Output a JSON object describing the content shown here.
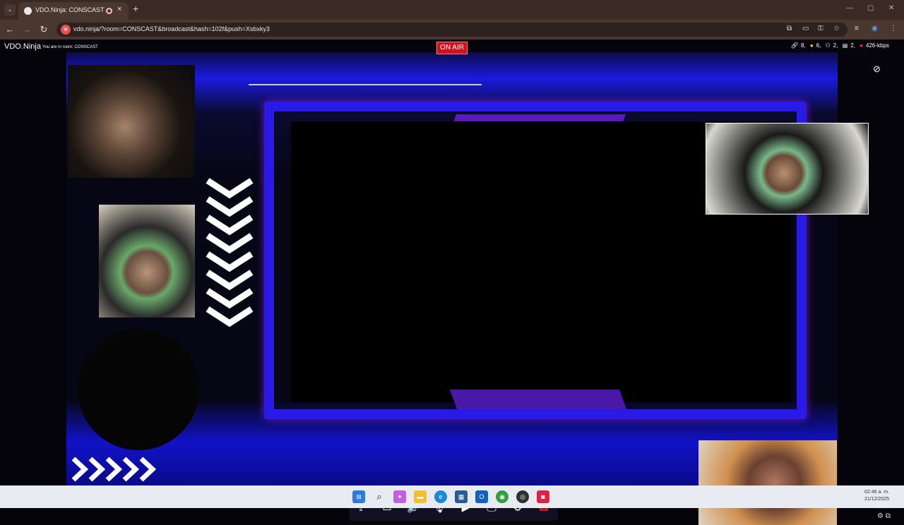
{
  "browser": {
    "tab_title": "VDO.Ninja: CONSCAST",
    "url": "vdo.ninja/?room=CONSCAST&broadcast&hash=102f&push=Xsbxky3",
    "nav": {
      "back": "←",
      "forward": "→",
      "reload": "↻"
    },
    "new_tab": "+",
    "tab_close": "×",
    "window_controls": [
      "—",
      "▢",
      "✕"
    ]
  },
  "app": {
    "brand": "VDO.Ninja",
    "room_label": "You are in room: CONSCAST",
    "on_air": "ON AIR",
    "stats": {
      "links": "8,",
      "bulbs": "6,",
      "viewers": "2,",
      "tabs": "2,",
      "bitrate": "426-kbps"
    }
  },
  "controls": {
    "items": [
      {
        "name": "file-share-icon",
        "glyph": "⇪"
      },
      {
        "name": "chat-icon",
        "glyph": "▭"
      },
      {
        "name": "speaker-icon",
        "glyph": "🔊"
      },
      {
        "name": "microphone-icon",
        "glyph": "🎙"
      },
      {
        "name": "camera-icon",
        "glyph": "▶"
      },
      {
        "name": "screenshare-icon",
        "glyph": "🖵"
      },
      {
        "name": "settings-icon",
        "glyph": "⚙"
      },
      {
        "name": "hangup-icon",
        "glyph": "☎"
      }
    ],
    "hangup_color": "#e02020"
  },
  "taskbar": {
    "time": "02:46 a. m.",
    "date": "21/12/2025"
  },
  "colors": {
    "onair_bg": "#d01020",
    "frame_blue": "#2a1ae8",
    "frame_purple": "#5a1ab8"
  }
}
